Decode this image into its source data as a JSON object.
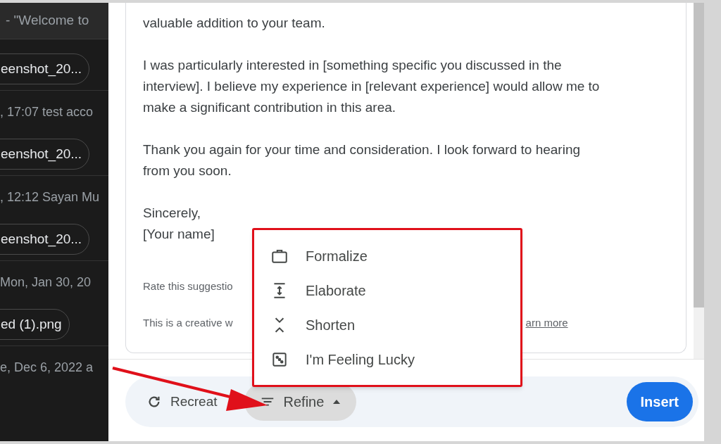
{
  "sidebar": {
    "title": "- \"Welcome to",
    "items": [
      {
        "kind": "chip",
        "label": "eenshot_20..."
      },
      {
        "kind": "meta",
        "label": ", 17:07 test acco"
      },
      {
        "kind": "chip",
        "label": "eenshot_20..."
      },
      {
        "kind": "meta",
        "label": ", 12:12 Sayan Mu"
      },
      {
        "kind": "chip",
        "label": "eenshot_20..."
      },
      {
        "kind": "meta",
        "label": " Mon, Jan 30, 20"
      },
      {
        "kind": "chip",
        "label": "ed (1).png"
      },
      {
        "kind": "meta",
        "label": "e, Dec 6, 2022 a"
      }
    ]
  },
  "draft": {
    "paragraphs": [
      [
        "valuable addition to your team."
      ],
      [
        "I was particularly interested in [something specific you discussed in the",
        "interview]. I believe my experience in [relevant experience] would allow me to",
        "make a significant contribution in this area."
      ],
      [
        "Thank you again for your time and consideration. I look forward to hearing",
        "from you soon."
      ],
      [
        "Sincerely,",
        "[Your name]"
      ]
    ],
    "rating_text": "Rate this suggestio",
    "disclaimer_text": "This is a creative w",
    "learn_more_link": "arn more"
  },
  "refine_menu": {
    "items": [
      {
        "kind": "briefcase",
        "label": "Formalize"
      },
      {
        "kind": "expand",
        "label": "Elaborate"
      },
      {
        "kind": "shorten",
        "label": "Shorten"
      },
      {
        "kind": "dice",
        "label": "I'm Feeling Lucky"
      }
    ]
  },
  "toolbar": {
    "recreate": "Recreat",
    "refine": "Refine",
    "refine_expanded": true,
    "insert": "Insert"
  }
}
